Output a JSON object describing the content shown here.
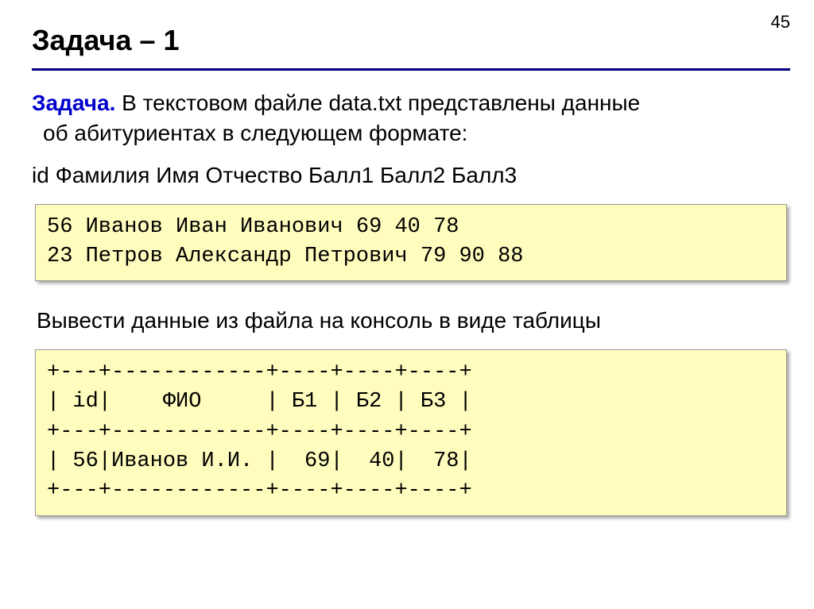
{
  "page_number": "45",
  "title": "Задача – 1",
  "problem": {
    "emphasis": "Задача.",
    "line1_rest": " В текстовом файле data.txt представлены данные",
    "line2": "об абитуриентах в следующем формате:"
  },
  "format_line": "id Фамилия Имя Отчество Балл1 Балл2 Балл3",
  "code1": {
    "line1": "56 Иванов Иван Иванович 69 40 78",
    "line2": "23 Петров Александр Петрович 79 90 88"
  },
  "output_intro": "Вывести данные из файла на консоль в виде таблицы",
  "code2": {
    "line1": "+---+------------+----+----+----+",
    "line2": "| id|    ФИО     | Б1 | Б2 | Б3 |",
    "line3": "+---+------------+----+----+----+",
    "line4": "| 56|Иванов И.И. |  69|  40|  78|",
    "line5": "+---+------------+----+----+----+"
  }
}
